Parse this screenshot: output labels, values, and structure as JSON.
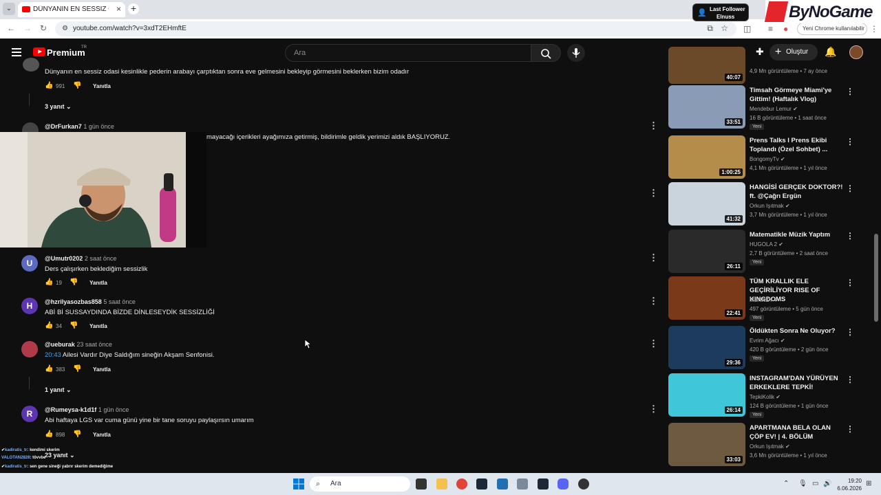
{
  "browser": {
    "tab_title": "DÜNYANIN EN SESSİZ ODASI!",
    "url": "youtube.com/watch?v=3xdT2EHmftE",
    "chrome_notice": "Yeni Chrome kullanılabilir"
  },
  "overlay": {
    "last_follower_label": "Last Follower",
    "last_follower_name": "Elnuss",
    "sponsor": "ByNoGame"
  },
  "youtube": {
    "premium_label": "Premium",
    "region": "TR",
    "search_placeholder": "Ara",
    "create_label": "Oluştur"
  },
  "comments": [
    {
      "text": "Dünyanın en sessiz odasi kesinlikle pederin arabayı çarptıktan sonra eve gelmesini bekleyip görmesini beklerken bizim odadır",
      "likes": "991",
      "reply_label": "Yanıtla",
      "replies_label": "3 yanıt"
    },
    {
      "user": "@DrFurkan7",
      "time": "1 gün önce",
      "text": "mayacağı içerikleri ayağımıza getirmiş, bildirimle geldik yerimizi aldık BAŞLIYORUZ."
    },
    {
      "user": "@Umutr0202",
      "time": "2 saat önce",
      "text": "Ders çalışırken beklediğim sessizlik",
      "likes": "19",
      "reply_label": "Yanıtla",
      "avatar_letter": "U",
      "avatar_color": "#5c6bc0"
    },
    {
      "user": "@hzrilyasozbas858",
      "time": "5 saat önce",
      "text": "ABİ Bİ SUSSAYDINDA BİZDE DİNLESEYDİK SESSİZLİĞİ",
      "likes": "34",
      "reply_label": "Yanıtla",
      "avatar_letter": "H",
      "avatar_color": "#5e35b1"
    },
    {
      "user": "@ueburak",
      "time": "23 saat önce",
      "timestamp_link": "20:43",
      "text": "Ailesi Vardır Diye Saldığım sineğin Akşam Senfonisi.",
      "likes": "383",
      "reply_label": "Yanıtla",
      "replies_label": "1 yanıt"
    },
    {
      "user": "@Rumeysa-k1d1f",
      "time": "1 gün önce",
      "text": "Abi haftaya LGS var cuma günü yine bir tane soruyu paylaşırsın umarım",
      "likes": "898",
      "reply_label": "Yanıtla",
      "replies_label": "23 yanıt",
      "avatar_letter": "R",
      "avatar_color": "#5e35b1"
    }
  ],
  "videos": [
    {
      "title": "",
      "channel": "",
      "meta": "4,9 Mn görüntüleme • 7 ay önce",
      "duration": "40:07",
      "thumb_color": "#6b4a2a"
    },
    {
      "title": "Timsah Görmeye Miami'ye Gittim! (Haftalık Vlog)",
      "channel": "Mendebur Lemur",
      "meta": "16 B görüntüleme • 1 saat önce",
      "duration": "33:51",
      "new": "Yeni",
      "thumb_color": "#8a9bb5"
    },
    {
      "title": "Prens Talks l Prens Ekibi Toplandı (Özel Sohbet) ...",
      "channel": "BongomyTv",
      "meta": "4,1 Mn görüntüleme • 1 yıl önce",
      "duration": "1:00:25",
      "thumb_color": "#b58d4a"
    },
    {
      "title": "HANGİSİ GERÇEK DOKTOR?! ft. @Çağrı Ergün",
      "channel": "Orkun Işıtmak",
      "meta": "3,7 Mn görüntüleme • 1 yıl önce",
      "duration": "41:32",
      "thumb_color": "#c9d4dc"
    },
    {
      "title": "Matematikle Müzik Yaptım",
      "channel": "HUGOLA 2",
      "meta": "2,7 B görüntüleme • 2 saat önce",
      "duration": "26:11",
      "new": "Yeni",
      "thumb_color": "#2a2a2a"
    },
    {
      "title": "TÜM KRALLIK ELE GEÇİRİLİYOR RISE OF KINGDOMS",
      "channel": "MENNZY",
      "meta": "497 görüntüleme • 5 gün önce",
      "duration": "22:41",
      "new": "Yeni",
      "thumb_color": "#7a3a1a"
    },
    {
      "title": "Öldükten Sonra Ne Oluyor?",
      "channel": "Evrim Ağacı",
      "meta": "420 B görüntüleme • 2 gün önce",
      "duration": "29:36",
      "new": "Yeni",
      "thumb_color": "#1d3b5c"
    },
    {
      "title": "INSTAGRAM'DAN YÜRÜYEN ERKEKLERE TEPKİ!",
      "channel": "TepkiKolik",
      "meta": "124 B görüntüleme • 1 gün önce",
      "duration": "26:14",
      "new": "Yeni",
      "thumb_color": "#3fc6d8"
    },
    {
      "title": "APARTMANA BELA OLAN ÇÖP EV! | 4. BÖLÜM",
      "channel": "Orkun Işıtmak",
      "meta": "3,6 Mn görüntüleme • 1 yıl önce",
      "duration": "33:03",
      "thumb_color": "#6d5a40"
    }
  ],
  "chat": [
    {
      "user": "kadiratis_tr",
      "msg": "kendimi skerim"
    },
    {
      "user": "VALOTAN2828",
      "msg": "tövvbe"
    },
    {
      "user": "kadiratis_tr",
      "msg": "sen gene sineği yabrır skerim demediğime"
    }
  ],
  "taskbar": {
    "search_label": "Ara",
    "time": "19:20",
    "date": "6.06.2026"
  }
}
